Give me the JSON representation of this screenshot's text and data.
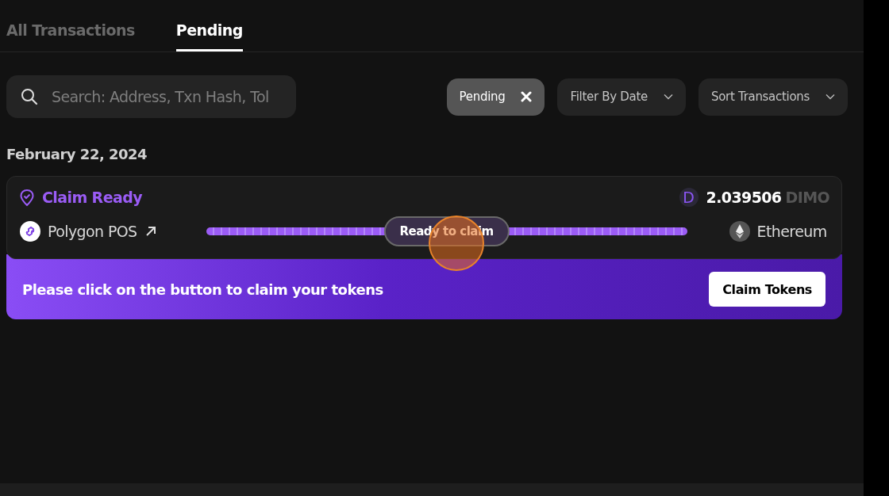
{
  "tabs": [
    {
      "label": "All Transactions",
      "selected": false
    },
    {
      "label": "Pending",
      "selected": true
    }
  ],
  "search": {
    "placeholder": "Search: Address, Txn Hash, Tol"
  },
  "filters": [
    {
      "kind": "chip",
      "label": "Pending"
    },
    {
      "kind": "dropdown",
      "label": "Filter By Date"
    },
    {
      "kind": "dropdown",
      "label": "Sort Transactions"
    }
  ],
  "groups": [
    {
      "date": "February 22, 2024",
      "transactions": [
        {
          "status": "Claim Ready",
          "token_icon_letter": "D",
          "amount": "2.039506",
          "token": "DIMO",
          "from": "Polygon POS",
          "to": "Ethereum",
          "progress": {
            "label": "Ready to claim",
            "level": 1
          },
          "banner": {
            "message": "Please click on the button to claim your tokens",
            "button": "Claim Tokens"
          }
        }
      ]
    }
  ]
}
